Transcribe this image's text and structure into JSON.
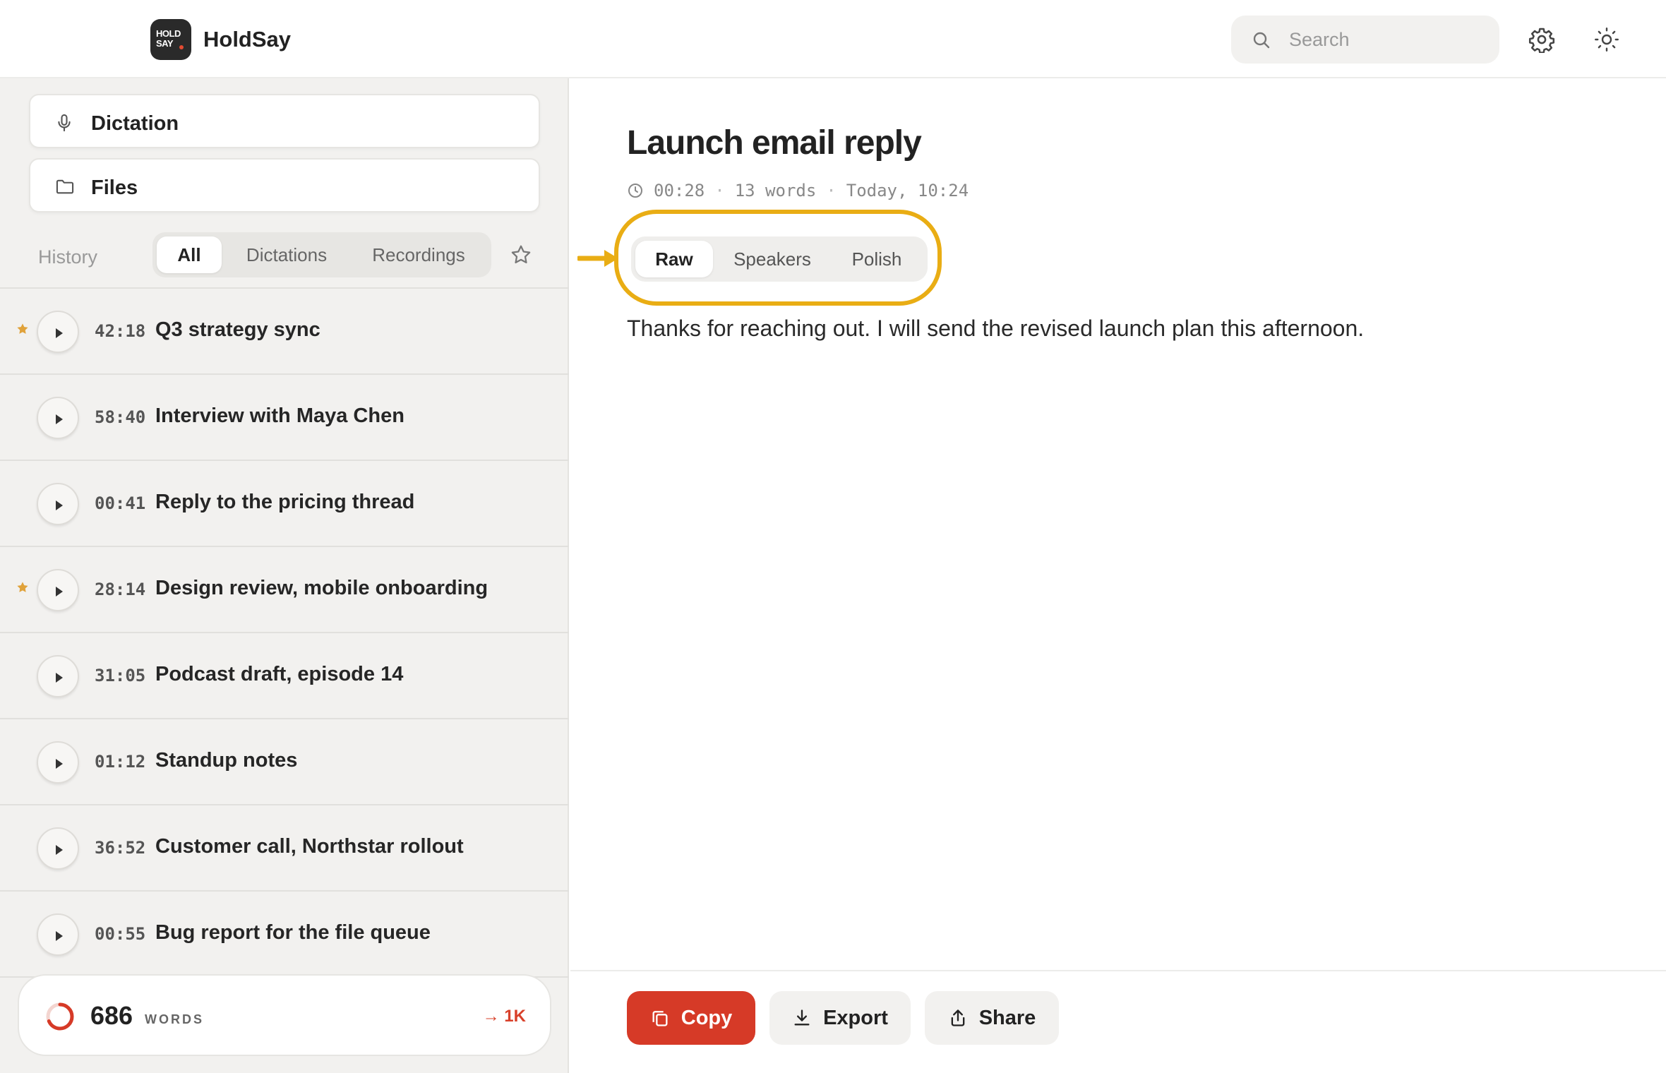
{
  "app": {
    "logo_text_line1": "HOLD",
    "logo_text_line2": "SAY",
    "brand_name": "HoldSay",
    "accent_color": "#d63a27",
    "highlight_color": "#e9ad14"
  },
  "header": {
    "search_placeholder": "Search",
    "icons": [
      "search-icon",
      "gear-icon",
      "sun-icon"
    ]
  },
  "sidebar": {
    "nav": [
      {
        "label": "Dictation",
        "icon": "microphone-icon"
      },
      {
        "label": "Files",
        "icon": "folder-icon"
      }
    ],
    "history_label": "History",
    "filter_tabs": [
      {
        "label": "All",
        "active": true
      },
      {
        "label": "Dictations",
        "active": false
      },
      {
        "label": "Recordings",
        "active": false
      }
    ],
    "items": [
      {
        "duration": "42:18",
        "title": "Q3 strategy sync",
        "starred": true
      },
      {
        "duration": "58:40",
        "title": "Interview with Maya Chen",
        "starred": false
      },
      {
        "duration": "00:41",
        "title": "Reply to the pricing thread",
        "starred": false
      },
      {
        "duration": "28:14",
        "title": "Design review, mobile onboarding",
        "starred": true
      },
      {
        "duration": "31:05",
        "title": "Podcast draft, episode 14",
        "starred": false
      },
      {
        "duration": "01:12",
        "title": "Standup notes",
        "starred": false
      },
      {
        "duration": "36:52",
        "title": "Customer call, Northstar rollout",
        "starred": false
      },
      {
        "duration": "00:55",
        "title": "Bug report for the file queue",
        "starred": false
      }
    ],
    "stats": {
      "words": "686",
      "unit": "WORDS",
      "goal": "→ 1K",
      "progress_fraction": 0.686
    }
  },
  "main": {
    "title": "Launch email reply",
    "meta": {
      "duration": "00:28",
      "words": "13 words",
      "time": "Today, 10:24"
    },
    "view_tabs": [
      {
        "label": "Raw",
        "active": true
      },
      {
        "label": "Speakers",
        "active": false
      },
      {
        "label": "Polish",
        "active": false
      }
    ],
    "transcript": "Thanks for reaching out. I will send the revised launch plan this afternoon.",
    "actions": {
      "copy": "Copy",
      "export": "Export",
      "share": "Share"
    }
  }
}
